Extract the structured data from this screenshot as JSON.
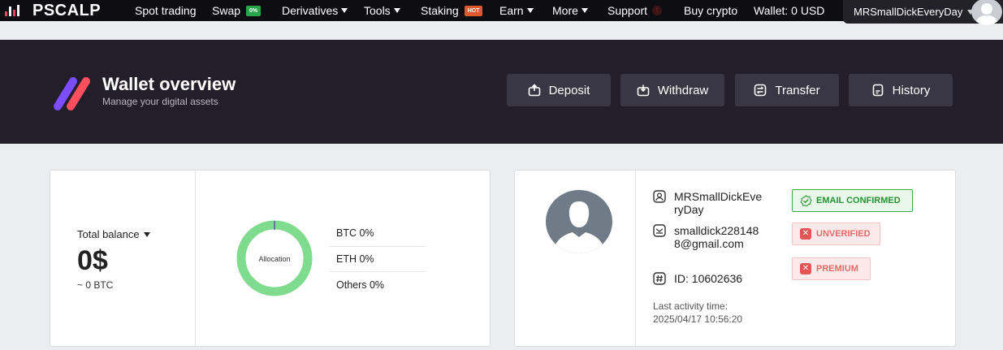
{
  "nav": {
    "brand": "PSCALP",
    "items": [
      {
        "label": "Spot trading"
      },
      {
        "label": "Swap",
        "badge": "0%"
      },
      {
        "label": "Derivatives"
      },
      {
        "label": "Tools"
      },
      {
        "label": "Staking",
        "badge": "HOT"
      },
      {
        "label": "Earn"
      },
      {
        "label": "More"
      },
      {
        "label": "Support"
      },
      {
        "label": "Buy crypto"
      },
      {
        "label": "Wallet: 0 USD"
      }
    ],
    "username": "MRSmallDickEveryDay"
  },
  "header": {
    "title": "Wallet overview",
    "subtitle": "Manage your digital assets",
    "buttons": {
      "deposit": "Deposit",
      "withdraw": "Withdraw",
      "transfer": "Transfer",
      "history": "History"
    }
  },
  "balance": {
    "label": "Total balance",
    "value": "0$",
    "btc": "~ 0 BTC"
  },
  "allocation": {
    "center_label": "Allocation",
    "rows": [
      "BTC 0%",
      "ETH 0%",
      "Others 0%"
    ],
    "ring_color": "#7fdc8e"
  },
  "profile": {
    "name": "MRSmallDickEveryDay",
    "email": "smalldick2281488@gmail.com",
    "id": "ID: 10602636",
    "last_activity_label": "Last activity time:",
    "last_activity_time": "2025/04/17 10:56:20",
    "badges": {
      "email": "EMAIL CONFIRMED",
      "verified": "UNVERIFIED",
      "premium": "PREMIUM"
    }
  },
  "colors": {
    "nav_bg": "#0e0d12",
    "header_bg": "#231f2a",
    "button_bg": "#3a3744",
    "confirmed_green": "#279133",
    "error_red": "#e25656"
  }
}
